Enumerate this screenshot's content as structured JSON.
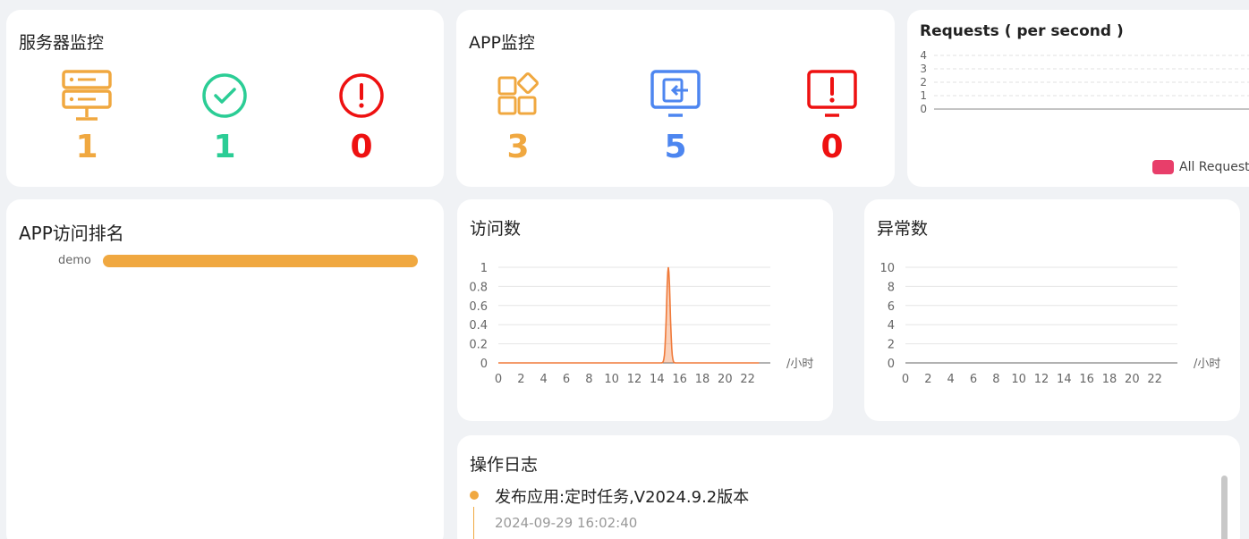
{
  "server_monitor": {
    "title": "服务器监控",
    "stats": [
      {
        "icon": "server-icon",
        "value": "1",
        "color": "#f0a840"
      },
      {
        "icon": "check-circle-icon",
        "value": "1",
        "color": "#2bcd95"
      },
      {
        "icon": "alert-circle-icon",
        "value": "0",
        "color": "#ee1111"
      }
    ]
  },
  "app_monitor": {
    "title": "APP监控",
    "stats": [
      {
        "icon": "app-grid-icon",
        "value": "3",
        "color": "#f0a840"
      },
      {
        "icon": "monitor-login-icon",
        "value": "5",
        "color": "#4d86f0"
      },
      {
        "icon": "monitor-alert-icon",
        "value": "0",
        "color": "#ee1111"
      }
    ]
  },
  "requests": {
    "title": "Requests ( per second )",
    "y_ticks": [
      "4",
      "3",
      "2",
      "1",
      "0"
    ],
    "legend": "All Request",
    "legend_color": "#e83e6a"
  },
  "app_ranking": {
    "title": "APP访问排名",
    "items": [
      {
        "label": "demo",
        "value": 1
      }
    ]
  },
  "visits": {
    "title": "访问数",
    "unit": "/小时",
    "chart_data": {
      "type": "area",
      "x": [
        0,
        1,
        2,
        3,
        4,
        5,
        6,
        7,
        8,
        9,
        10,
        11,
        12,
        13,
        14,
        15,
        16,
        17,
        18,
        19,
        20,
        21,
        22,
        23
      ],
      "series": [
        {
          "values": [
            0,
            0,
            0,
            0,
            0,
            0,
            0,
            0,
            0,
            0,
            0,
            0,
            0,
            0,
            0,
            1,
            0,
            0,
            0,
            0,
            0,
            0,
            0,
            0
          ]
        }
      ],
      "x_ticks": [
        "0",
        "2",
        "4",
        "6",
        "8",
        "10",
        "12",
        "14",
        "16",
        "18",
        "20",
        "22"
      ],
      "y_ticks": [
        "1",
        "0.8",
        "0.6",
        "0.4",
        "0.2",
        "0"
      ],
      "ylim": [
        0,
        1
      ],
      "color": "#f07a3a"
    }
  },
  "errors": {
    "title": "异常数",
    "unit": "/小时",
    "chart_data": {
      "type": "line",
      "x_ticks": [
        "0",
        "2",
        "4",
        "6",
        "8",
        "10",
        "12",
        "14",
        "16",
        "18",
        "20",
        "22"
      ],
      "y_ticks": [
        "10",
        "8",
        "6",
        "4",
        "2",
        "0"
      ],
      "ylim": [
        0,
        10
      ]
    }
  },
  "operation_log": {
    "title": "操作日志",
    "entries": [
      {
        "text": "发布应用:定时任务,V2024.9.2版本",
        "time": "2024-09-29 16:02:40"
      }
    ]
  }
}
